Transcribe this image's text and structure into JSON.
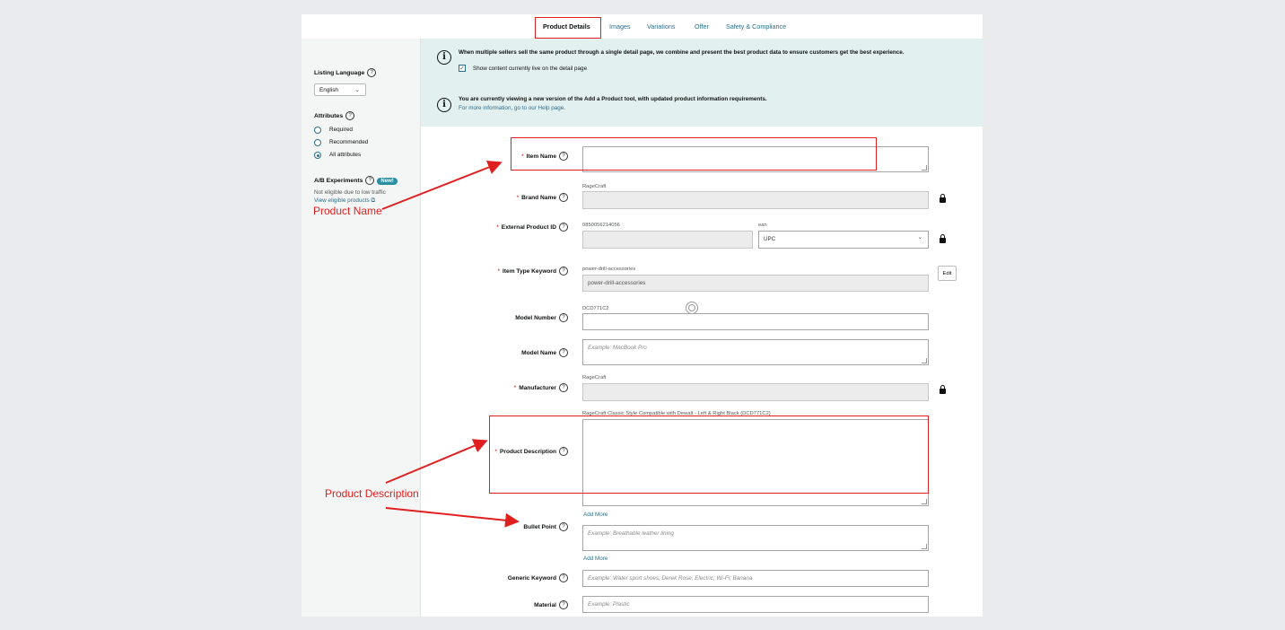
{
  "tabs": [
    "Product Details",
    "Images",
    "Variations",
    "Offer",
    "Safety & Compliance"
  ],
  "sidebar": {
    "listing_language_label": "Listing Language",
    "language_value": "English",
    "attributes_label": "Attributes",
    "attribute_options": [
      "Required",
      "Recommended",
      "All attributes"
    ],
    "ab_label": "A/B Experiments",
    "new_badge": "New!",
    "not_eligible": "Not eligible due to low traffic",
    "view_eligible": "View eligible products"
  },
  "notices": {
    "multi_seller": "When multiple sellers sell the same product through a single detail page, we combine and present the best product data to ensure customers get the best experience.",
    "show_live": "Show content currently live on the detail page",
    "new_version": "You are currently viewing a new version of the Add a Product tool, with updated product information requirements.",
    "help": "For more information, go to our Help page."
  },
  "form": {
    "item_name": "Item Name",
    "brand_name": "Brand Name",
    "brand_hint": "RageCraft",
    "external_id": "External Product ID",
    "external_hint": "0850056214056",
    "ean_hint": "ean",
    "id_type": "UPC",
    "item_type": "Item Type Keyword",
    "item_type_hint": "power-drill-accessories",
    "item_type_value": "power-drill-accessories",
    "edit": "Edit",
    "model_number": "Model Number",
    "model_number_hint": "DCD771C2",
    "model_name": "Model Name",
    "model_name_ph": "Example: MacBook Pro",
    "manufacturer": "Manufacturer",
    "manufacturer_hint": "RageCraft",
    "desc_hint": "RageCraft Classic Style Compatible with Dewalt - Left & Right Black (DCD771C2)",
    "product_description": "Product Description",
    "add_more": "Add More",
    "bullet_point": "Bullet Point",
    "bullet_ph": "Example: Breathable leather lining",
    "generic_keyword": "Generic Keyword",
    "generic_ph": "Example: Water sport shoes; Derek Rose; Electric; Wi-Fi; Banana",
    "material": "Material",
    "material_ph": "Example: Plastic"
  },
  "annotations": {
    "product_name": "Product Name",
    "product_description": "Product Description"
  }
}
